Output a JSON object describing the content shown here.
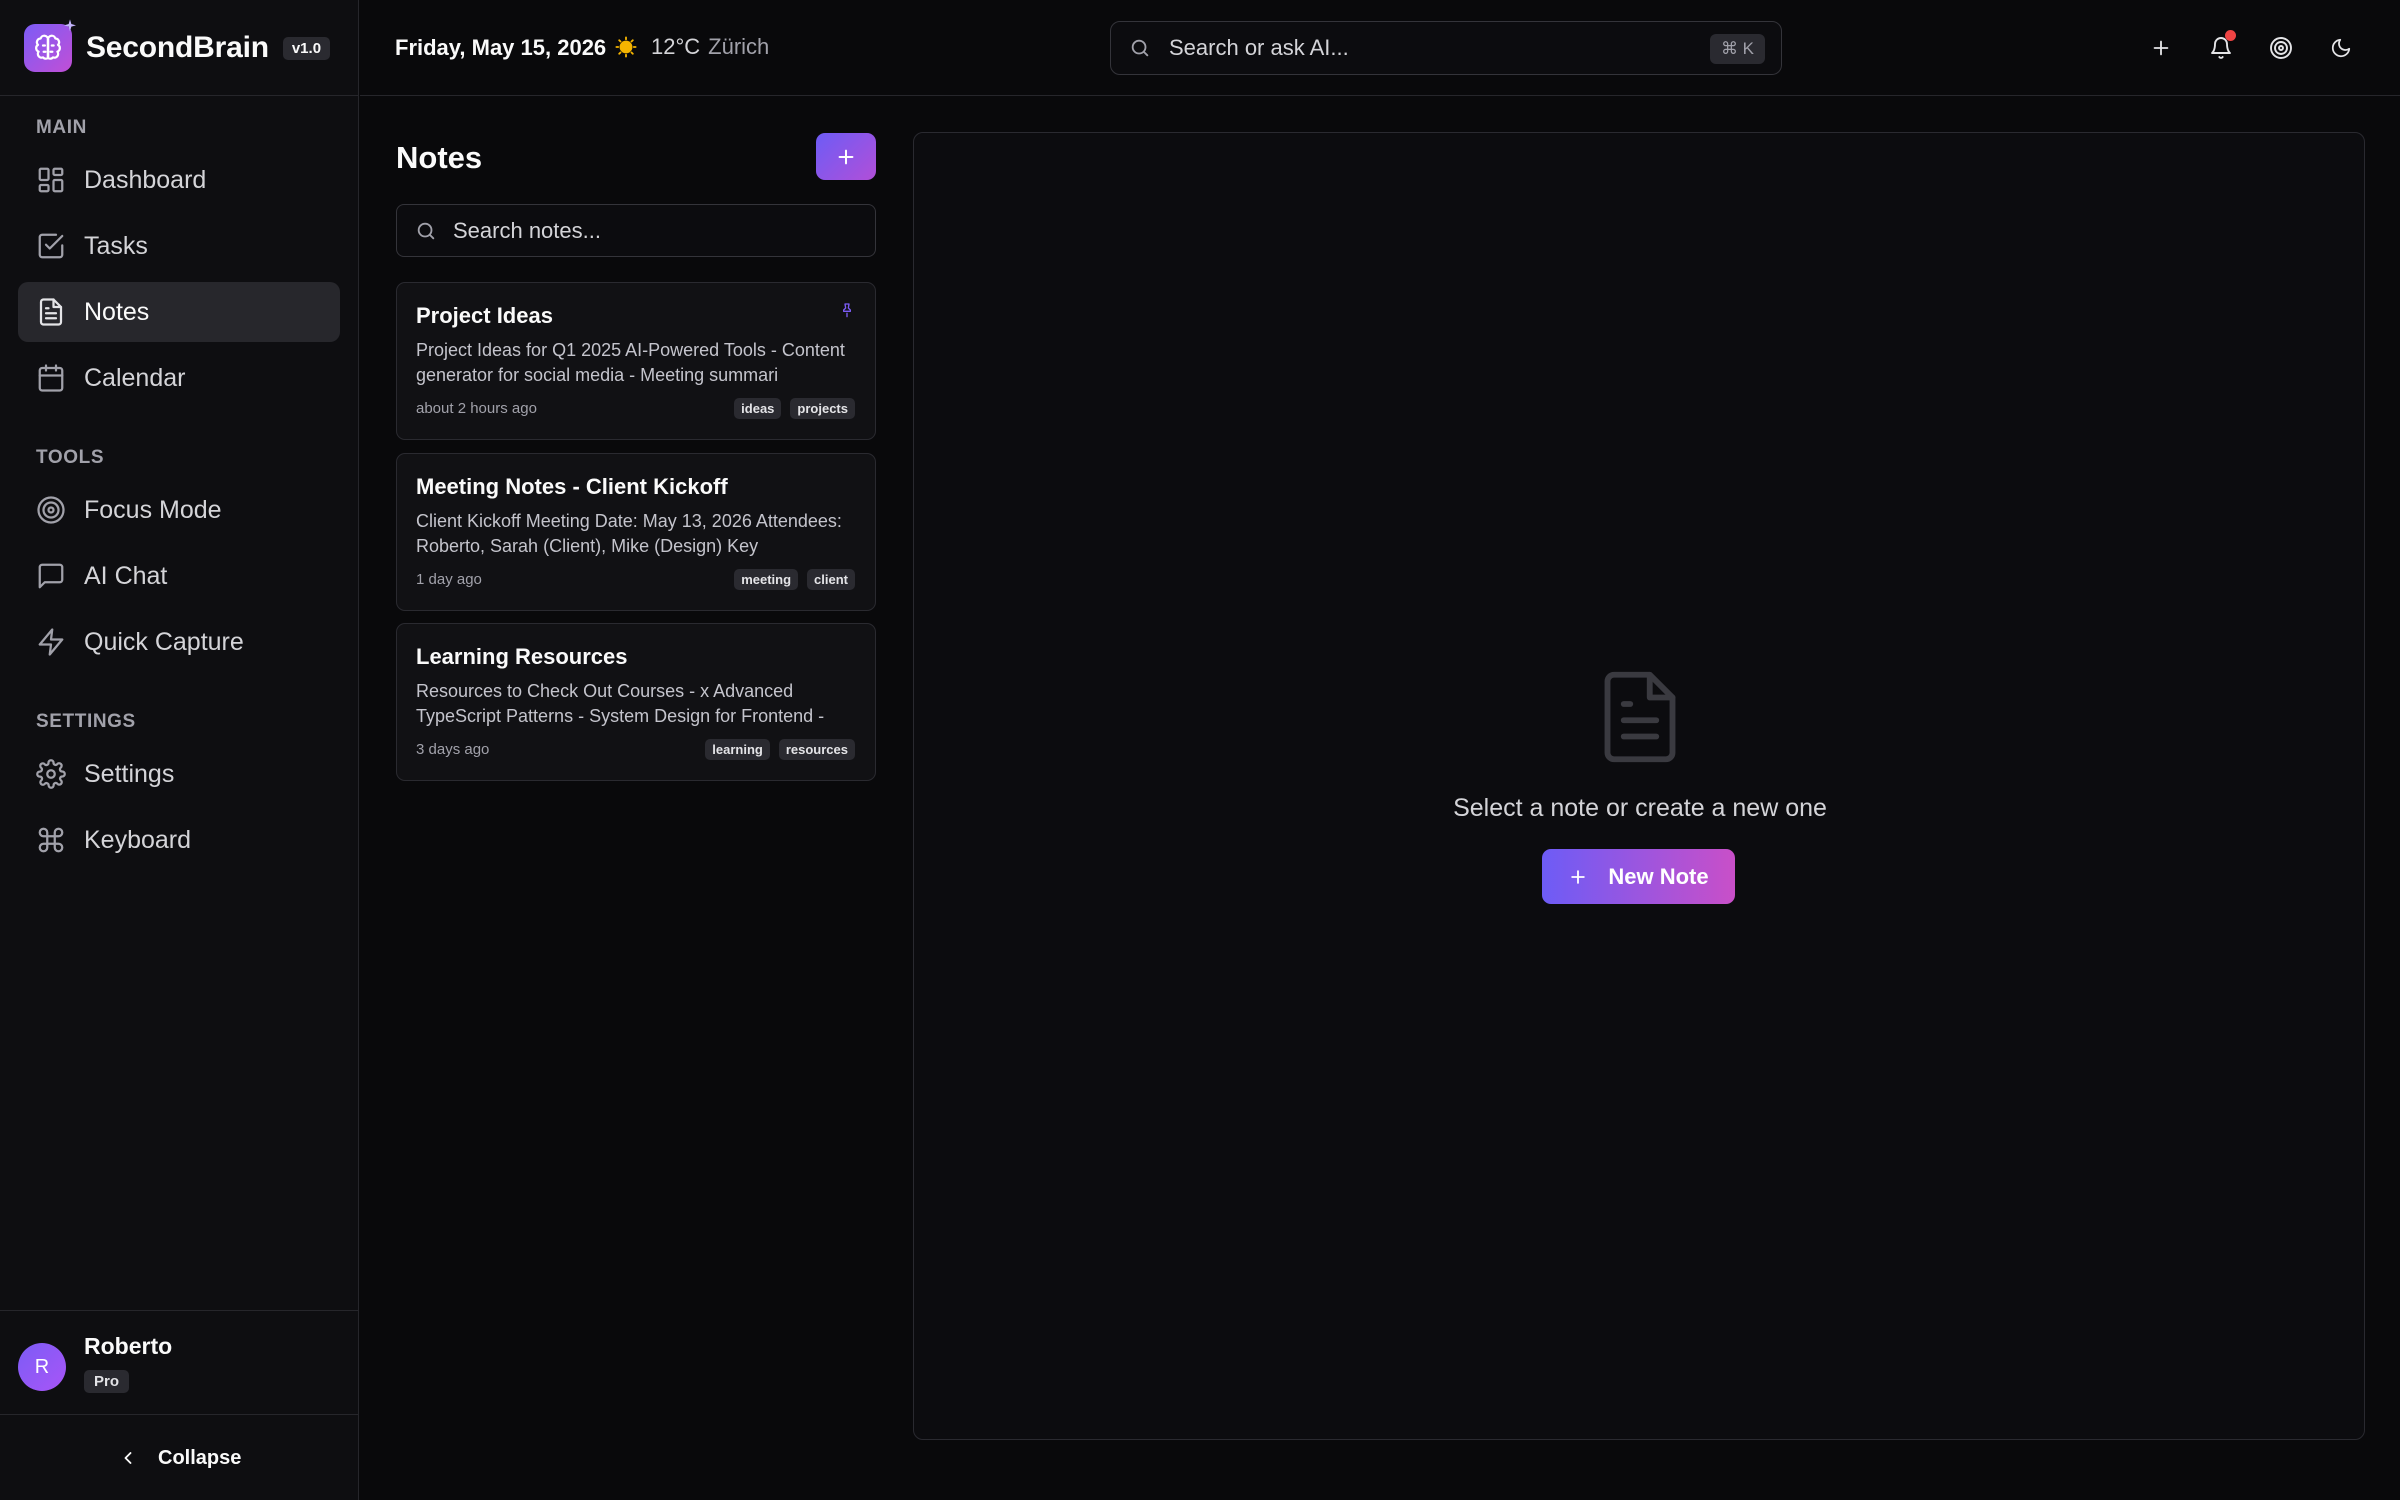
{
  "brand": {
    "name": "SecondBrain",
    "version": "v1.0"
  },
  "sidebar": {
    "sections": [
      {
        "title": "MAIN",
        "items": [
          {
            "label": "Dashboard",
            "icon": "dashboard-icon"
          },
          {
            "label": "Tasks",
            "icon": "tasks-icon"
          },
          {
            "label": "Notes",
            "icon": "notes-icon",
            "active": true
          },
          {
            "label": "Calendar",
            "icon": "calendar-icon"
          }
        ]
      },
      {
        "title": "TOOLS",
        "items": [
          {
            "label": "Focus Mode",
            "icon": "target-icon"
          },
          {
            "label": "AI Chat",
            "icon": "chat-icon"
          },
          {
            "label": "Quick Capture",
            "icon": "lightning-icon"
          }
        ]
      },
      {
        "title": "SETTINGS",
        "items": [
          {
            "label": "Settings",
            "icon": "gear-icon"
          },
          {
            "label": "Keyboard",
            "icon": "command-icon"
          }
        ]
      }
    ],
    "user": {
      "initial": "R",
      "name": "Roberto",
      "plan": "Pro"
    },
    "collapse_label": "Collapse"
  },
  "header": {
    "date": "Friday, May 15, 2026",
    "weather": {
      "temp": "12°C",
      "city": "Zürich"
    },
    "search_placeholder": "Search or ask AI...",
    "search_shortcut": "⌘ K"
  },
  "notes": {
    "title": "Notes",
    "search_placeholder": "Search notes...",
    "items": [
      {
        "title": "Project Ideas",
        "preview": "Project Ideas for Q1 2025 AI-Powered Tools - Content generator for social media - Meeting summari",
        "time": "about 2 hours ago",
        "tags": [
          "ideas",
          "projects"
        ],
        "pinned": true
      },
      {
        "title": "Meeting Notes - Client Kickoff",
        "preview": "Client Kickoff Meeting Date: May 13, 2026 Attendees: Roberto, Sarah (Client), Mike (Design) Key",
        "time": "1 day ago",
        "tags": [
          "meeting",
          "client"
        ]
      },
      {
        "title": "Learning Resources",
        "preview": "Resources to Check Out Courses - x Advanced TypeScript Patterns - System Design for Frontend -",
        "time": "3 days ago",
        "tags": [
          "learning",
          "resources"
        ]
      }
    ]
  },
  "editor": {
    "empty_text": "Select a note or create a new one",
    "new_note_label": "New Note"
  },
  "colors": {
    "accent": "#7c5cf6",
    "accent_end": "#c94fc8",
    "notification_dot": "#ef4444",
    "weather_sun": "#f5b400"
  }
}
